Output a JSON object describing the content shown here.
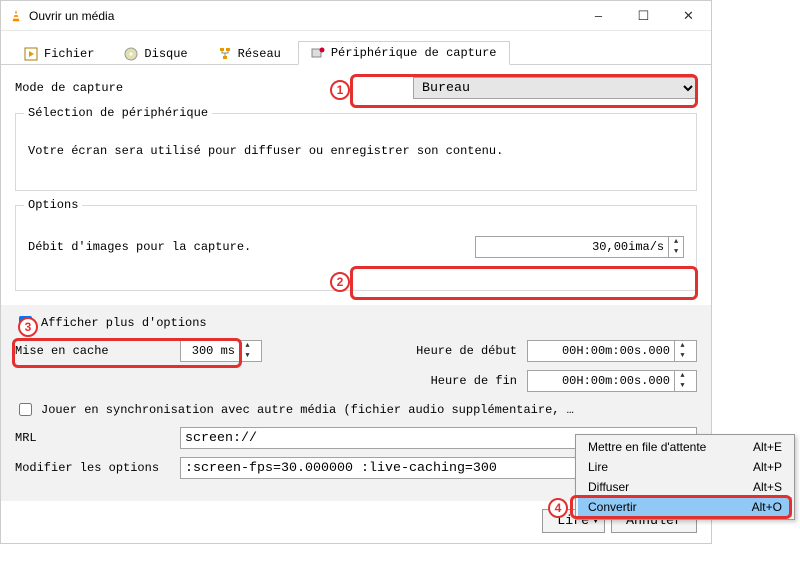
{
  "window": {
    "title": "Ouvrir un média"
  },
  "winbtns": {
    "min": "–",
    "max": "☐",
    "close": "✕"
  },
  "tabs": {
    "file": "Fichier",
    "disc": "Disque",
    "network": "Réseau",
    "capture": "Périphérique de capture"
  },
  "capture": {
    "mode_label": "Mode de capture",
    "mode_value": "Bureau",
    "device_legend": "Sélection de périphérique",
    "device_desc": "Votre écran sera utilisé pour diffuser ou enregistrer son contenu.",
    "options_legend": "Options",
    "fps_label": "Débit d'images pour la capture.",
    "fps_value": "30,00ima/s"
  },
  "advanced": {
    "show_more": "Afficher plus d'options",
    "cache_label": "Mise en cache",
    "cache_value": "300 ms",
    "start_label": "Heure de début",
    "start_value": "00H:00m:00s.000",
    "end_label": "Heure de fin",
    "end_value": "00H:00m:00s.000",
    "sync_label": "Jouer en synchronisation avec autre média (fichier audio supplémentaire, …",
    "mrl_label": "MRL",
    "mrl_value": "screen://",
    "edit_label": "Modifier les options",
    "edit_value": ":screen-fps=30.000000 :live-caching=300"
  },
  "buttons": {
    "play": "Lire",
    "cancel": "Annuler"
  },
  "menu": {
    "queue": {
      "label": "Mettre en file d'attente",
      "accel": "Alt+E"
    },
    "play": {
      "label": "Lire",
      "accel": "Alt+P"
    },
    "stream": {
      "label": "Diffuser",
      "accel": "Alt+S"
    },
    "convert": {
      "label": "Convertir",
      "accel": "Alt+O"
    }
  },
  "annot": {
    "1": "1",
    "2": "2",
    "3": "3",
    "4": "4"
  }
}
